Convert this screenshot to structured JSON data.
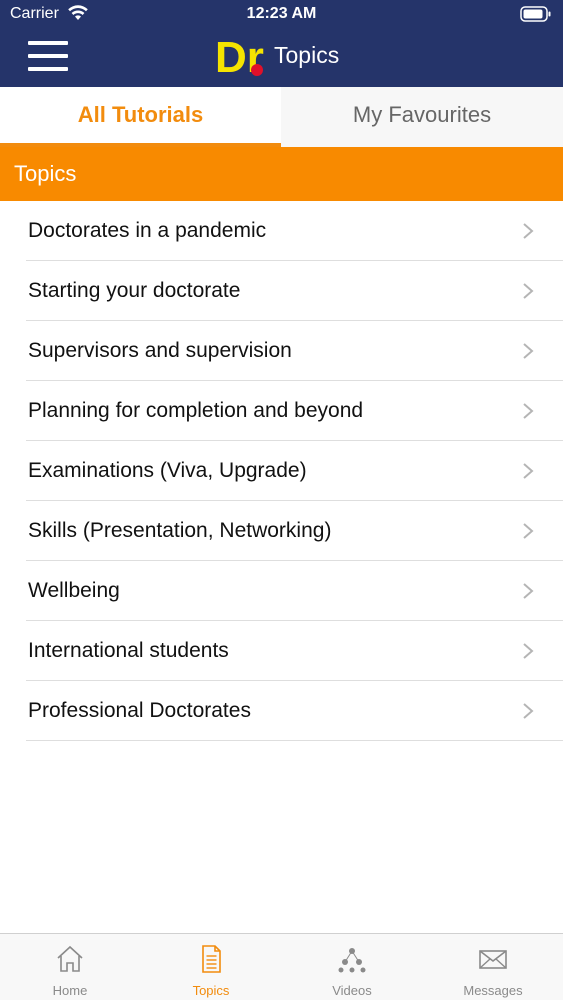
{
  "status_bar": {
    "carrier": "Carrier",
    "time": "12:23 AM",
    "icons": [
      "wifi-icon",
      "battery-icon"
    ]
  },
  "nav": {
    "title": "Topics",
    "logo_text": "Dr",
    "menu_icon": "hamburger-menu-icon"
  },
  "tabs": [
    {
      "label": "All Tutorials",
      "selected": true
    },
    {
      "label": "My Favourites",
      "selected": false
    }
  ],
  "section": {
    "title": "Topics"
  },
  "topics": [
    {
      "label": "Doctorates in a pandemic"
    },
    {
      "label": "Starting your doctorate"
    },
    {
      "label": "Supervisors and supervision"
    },
    {
      "label": "Planning for completion and beyond"
    },
    {
      "label": "Examinations (Viva, Upgrade)"
    },
    {
      "label": "Skills (Presentation, Networking)"
    },
    {
      "label": "Wellbeing"
    },
    {
      "label": "International students"
    },
    {
      "label": "Professional Doctorates"
    }
  ],
  "tabbar": [
    {
      "label": "Home",
      "icon": "home-icon",
      "active": false
    },
    {
      "label": "Topics",
      "icon": "document-icon",
      "active": true
    },
    {
      "label": "Videos",
      "icon": "network-icon",
      "active": false
    },
    {
      "label": "Messages",
      "icon": "envelope-icon",
      "active": false
    }
  ],
  "colors": {
    "navy": "#25346a",
    "accent_orange": "#f28c0e",
    "header_orange": "#f88a00",
    "logo_yellow": "#f5e400",
    "logo_red": "#e0102a"
  }
}
